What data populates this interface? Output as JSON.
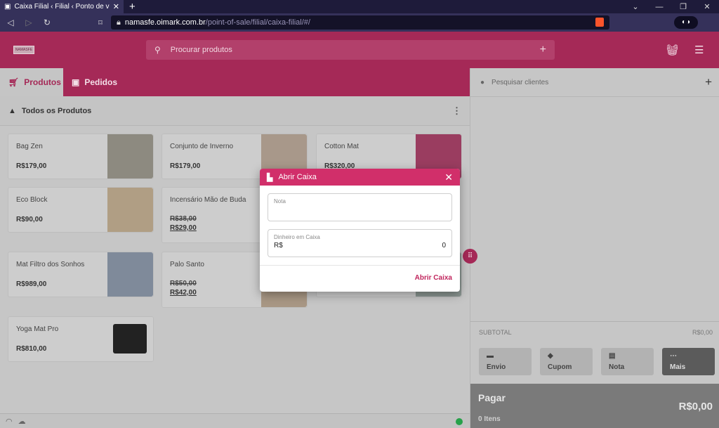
{
  "browser": {
    "tab_title": "Caixa Filial ‹ Filial ‹ Ponto de venda",
    "url_host": "namasfe.oimark.com.br",
    "url_path": "/point-of-sale/filial/caixa-filial/#/"
  },
  "header": {
    "logo_text": "NAMASFE",
    "search_placeholder": "Procurar produtos"
  },
  "tabs": {
    "products": "Produtos",
    "orders": "Pedidos"
  },
  "category": {
    "label": "Todos os Produtos"
  },
  "products": [
    {
      "name": "Bag Zen",
      "price": "R$179,00"
    },
    {
      "name": "Conjunto de Inverno",
      "price": "R$179,00"
    },
    {
      "name": "Cotton Mat",
      "price": "R$320,00"
    },
    {
      "name": "Eco Block",
      "price": "R$90,00"
    },
    {
      "name": "Incensário Mão de Buda",
      "old_price": "R$38,00",
      "new_price": "R$29,00"
    },
    {
      "name": "Mat Filtro dos Sonhos",
      "price": "R$989,00"
    },
    {
      "name": "Palo Santo",
      "old_price": "R$50,00",
      "new_price": "R$42,00"
    },
    {
      "name": "Yoga Mat Pro",
      "price": "R$810,00"
    }
  ],
  "cart": {
    "client_placeholder": "Pesquisar clientes",
    "subtotal_label": "SUBTOTAL",
    "subtotal_value": "R$0,00",
    "actions": [
      "Envio",
      "Cupom",
      "Nota",
      "Mais"
    ],
    "pay_label": "Pagar",
    "items_label": "0 Itens",
    "total": "R$0,00"
  },
  "modal": {
    "title": "Abrir Caixa",
    "note_label": "Nota",
    "cash_label": "Dinheiro em Caixa",
    "currency": "R$",
    "cash_value": "0",
    "submit": "Abrir Caixa"
  }
}
